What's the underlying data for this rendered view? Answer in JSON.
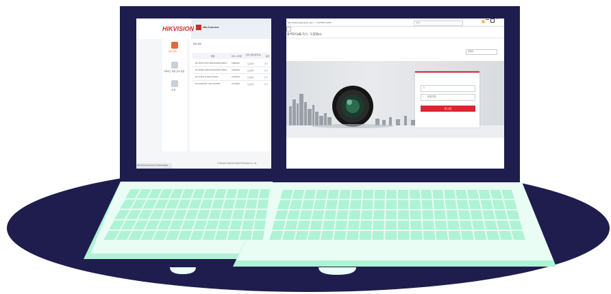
{
  "colors": {
    "background": "#ffffff",
    "navy": "#1f1d4d",
    "mint": "#aef3d4",
    "mint_light": "#e9fdf5",
    "brand_red": "#d7282f"
  },
  "left_screen": {
    "logo": "HIKVISION",
    "product_logo": "Hik-Connect",
    "sidebar_items": [
      "장치 관리",
      "디바이스 화면 관리 설정",
      "설 정"
    ],
    "panel_title": "장치 관리",
    "table_header": [
      "별칭",
      "장치 시리얼",
      "장치 상태(온라인)",
      "동작"
    ],
    "table_rows": [
      [
        "DS-7607NI-K4ST 0820191003CCWRC4",
        "C0820191",
        "오프라인",
        "관리"
      ],
      [
        "DS-7616NI-K4E4 0220191003CCWRC4",
        "C0220191",
        "오프라인",
        "관리"
      ],
      [
        "DS-7716NI-I4 1608 C220370",
        "C2203703",
        "오프라인",
        "관리"
      ],
      [
        "DS-2CD2120F-I 1012 C210390",
        "C1210390",
        "오프라인",
        "관리"
      ]
    ],
    "footer": "© Hangzhou Hikvision Digital Technology Co., Ltd.",
    "status_bar": "https://www.hik-connect.com/devices/page"
  },
  "right_screen": {
    "address": "http://ip/doc/page/login.asp?_ = 1627855 12345",
    "search_placeholder": "검색...",
    "menu": [
      "즐겨찾기(A)",
      "도구(T)",
      "도움말(H)"
    ],
    "language": "한국어",
    "username_placeholder": "",
    "password_placeholder": "비밀번호",
    "login_button": "로그인"
  }
}
